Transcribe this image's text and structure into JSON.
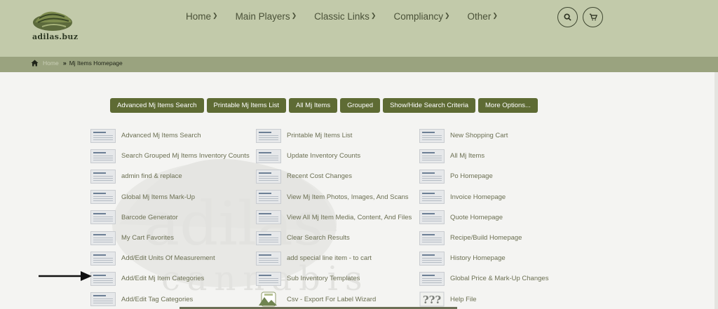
{
  "brand": {
    "logo_text": "adilas.buz"
  },
  "nav": [
    {
      "label": "Home"
    },
    {
      "label": "Main Players"
    },
    {
      "label": "Classic Links"
    },
    {
      "label": "Compliancy"
    },
    {
      "label": "Other"
    }
  ],
  "header_icons": {
    "search": "search-icon",
    "cart": "cart-icon"
  },
  "breadcrumb": {
    "home": "Home",
    "current": "Mj Items Homepage"
  },
  "actions": [
    {
      "label": "Advanced Mj Items Search"
    },
    {
      "label": "Printable Mj Items List"
    },
    {
      "label": "All Mj Items"
    },
    {
      "label": "Grouped"
    },
    {
      "label": "Show/Hide Search Criteria"
    },
    {
      "label": "More Options..."
    }
  ],
  "watermark": {
    "top": "adilas",
    "bottom": "cannabis"
  },
  "columns": [
    {
      "items": [
        {
          "label": "Advanced Mj Items Search"
        },
        {
          "label": "Search Grouped Mj Items Inventory Counts"
        },
        {
          "label": "admin find & replace"
        },
        {
          "label": "Global Mj Items Mark-Up"
        },
        {
          "label": "Barcode Generator"
        },
        {
          "label": "My Cart Favorites"
        },
        {
          "label": "Add/Edit Units Of Measurement"
        },
        {
          "label": "Add/Edit Mj Item Categories"
        },
        {
          "label": "Add/Edit Tag Categories"
        }
      ]
    },
    {
      "items": [
        {
          "label": "Printable Mj Items List"
        },
        {
          "label": "Update Inventory Counts"
        },
        {
          "label": "Recent Cost Changes"
        },
        {
          "label": "View Mj Item Photos, Images, And Scans"
        },
        {
          "label": "View All Mj Item Media, Content, And Files"
        },
        {
          "label": "Clear Search Results"
        },
        {
          "label": "add special line item - to cart"
        },
        {
          "label": "Sub Inventory Templates"
        },
        {
          "label": "Csv - Export For Label Wizard"
        }
      ]
    },
    {
      "items": [
        {
          "label": "New Shopping Cart"
        },
        {
          "label": "All Mj Items"
        },
        {
          "label": "Po Homepage"
        },
        {
          "label": "Invoice Homepage"
        },
        {
          "label": "Quote Homepage"
        },
        {
          "label": "Recipe/Build Homepage"
        },
        {
          "label": "History Homepage"
        },
        {
          "label": "Global Price & Mark-Up Changes"
        },
        {
          "label": "Help File"
        }
      ]
    }
  ],
  "colors": {
    "header": "#c2caaa",
    "crumb_bar": "#9aa37f",
    "button": "#5e6b34",
    "link_text": "#6b6f52"
  }
}
